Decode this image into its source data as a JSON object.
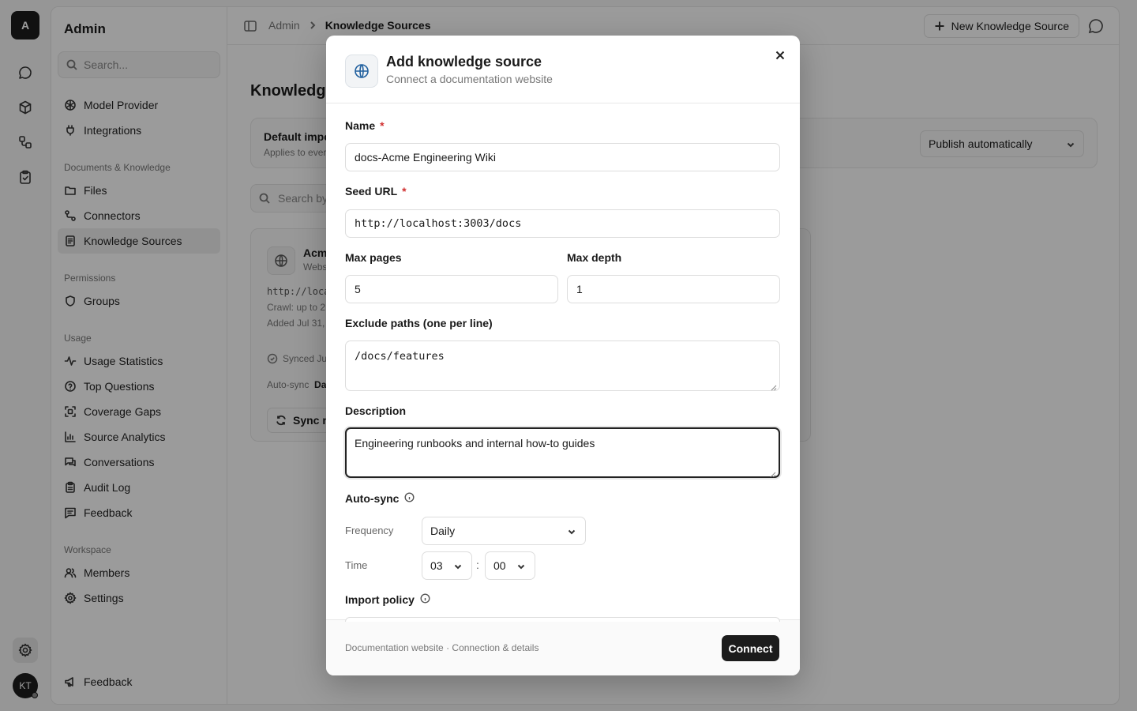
{
  "rail": {
    "logo": "A",
    "avatar": "KT"
  },
  "sidebar": {
    "title": "Admin",
    "search_placeholder": "Search...",
    "items_top": [
      {
        "label": "Model Provider"
      },
      {
        "label": "Integrations"
      }
    ],
    "sections": {
      "documents": "Documents & Knowledge",
      "permissions": "Permissions",
      "usage": "Usage",
      "workspace": "Workspace"
    },
    "documents_items": [
      {
        "label": "Files"
      },
      {
        "label": "Connectors"
      },
      {
        "label": "Knowledge Sources"
      }
    ],
    "permissions_items": [
      {
        "label": "Groups"
      }
    ],
    "usage_items": [
      {
        "label": "Usage Statistics"
      },
      {
        "label": "Top Questions"
      },
      {
        "label": "Coverage Gaps"
      },
      {
        "label": "Source Analytics"
      },
      {
        "label": "Conversations"
      },
      {
        "label": "Audit Log"
      },
      {
        "label": "Feedback"
      }
    ],
    "workspace_items": [
      {
        "label": "Members"
      },
      {
        "label": "Settings"
      }
    ],
    "bottom_feedback": "Feedback"
  },
  "topbar": {
    "crumb_parent": "Admin",
    "crumb_current": "Knowledge Sources",
    "new_button": "New Knowledge Source"
  },
  "main": {
    "title": "Knowledge",
    "policy_title": "Default impo",
    "policy_sub": "Applies to ever",
    "policy_select": "Publish automatically",
    "search_placeholder": "Search by",
    "card": {
      "name": "Acm",
      "type": "Webs",
      "url": "http://loca",
      "crawl": "Crawl: up to 2",
      "added": "Added Jul 31,",
      "synced": "Synced Ju",
      "autosync_label": "Auto-sync",
      "autosync_value": "Da",
      "sync_button": "Sync no"
    }
  },
  "modal": {
    "title": "Add knowledge source",
    "subtitle": "Connect a documentation website",
    "name_label": "Name",
    "name_value": "docs-Acme Engineering Wiki",
    "seed_label": "Seed URL",
    "seed_value": "http://localhost:3003/docs",
    "max_pages_label": "Max pages",
    "max_pages_value": "5",
    "max_depth_label": "Max depth",
    "max_depth_value": "1",
    "exclude_label": "Exclude paths (one per line)",
    "exclude_value": "/docs/features",
    "description_label": "Description",
    "description_value": "Engineering runbooks and internal how-to guides",
    "autosync_label": "Auto-sync",
    "frequency_label": "Frequency",
    "frequency_value": "Daily",
    "time_label": "Time",
    "time_hour": "03",
    "time_sep": ":",
    "time_minute": "00",
    "import_policy_label": "Import policy",
    "footer_text": "Documentation website · Connection & details",
    "connect_button": "Connect",
    "required_mark": "*"
  }
}
